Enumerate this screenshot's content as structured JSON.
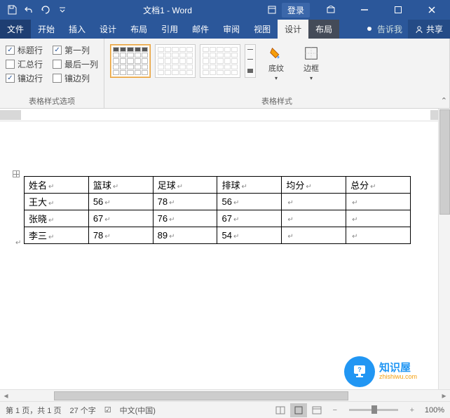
{
  "title": "文档1 - Word",
  "login": "登录",
  "tabs": [
    "文件",
    "开始",
    "插入",
    "设计",
    "布局",
    "引用",
    "邮件",
    "审阅",
    "视图",
    "设计",
    "布局"
  ],
  "tellMe": "告诉我",
  "share": "共享",
  "styleOptions": {
    "r1c1": "标题行",
    "r1c2": "第一列",
    "r2c1": "汇总行",
    "r2c2": "最后一列",
    "r3c1": "镶边行",
    "r3c2": "镶边列",
    "groupTitle": "表格样式选项"
  },
  "stylesGroupTitle": "表格样式",
  "shading": "底纹",
  "borders": "边框",
  "table": {
    "headers": [
      "姓名",
      "篮球",
      "足球",
      "排球",
      "均分",
      "总分"
    ],
    "rows": [
      [
        "王大",
        "56",
        "78",
        "56",
        "",
        ""
      ],
      [
        "张晓",
        "67",
        "76",
        "67",
        "",
        ""
      ],
      [
        "李三",
        "78",
        "89",
        "54",
        "",
        ""
      ]
    ]
  },
  "status": {
    "page": "第 1 页，共 1 页",
    "words": "27 个字",
    "lang": "中文(中国)",
    "zoom": "100%"
  },
  "watermark": {
    "brand": "知识屋",
    "url": "zhishiwu.com"
  }
}
